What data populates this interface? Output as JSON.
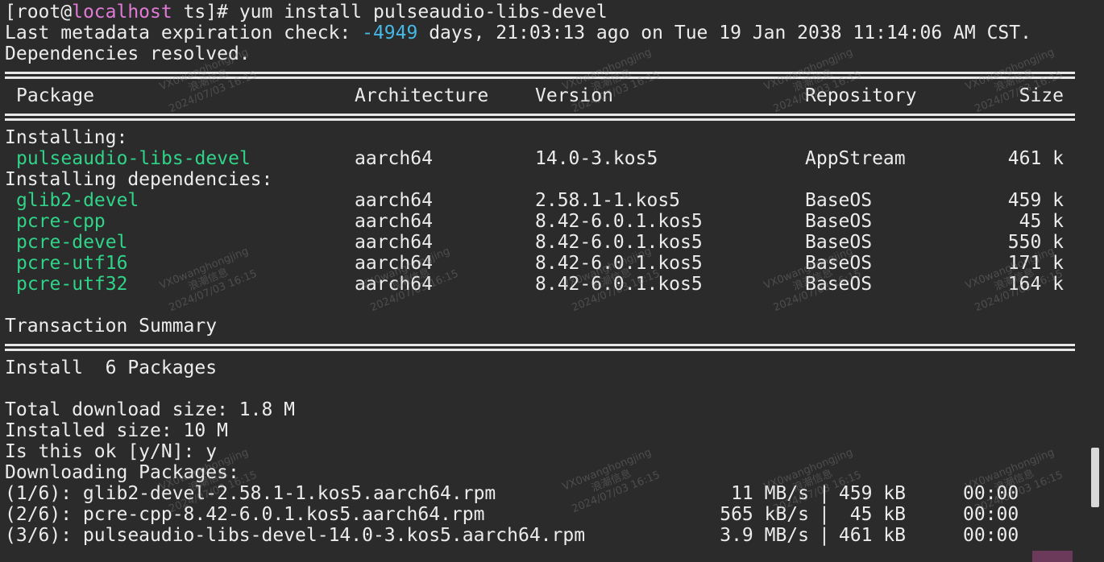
{
  "prompt": {
    "open": "[root@",
    "host": "localhost",
    "rest": " ts]# ",
    "command": "yum install pulseaudio-libs-devel"
  },
  "metadata": {
    "prefix": "Last metadata expiration check: ",
    "days": "-4949",
    "suffix": " days, 21:03:13 ago on Tue 19 Jan 2038 11:14:06 AM CST."
  },
  "deps_resolved": "Dependencies resolved.",
  "headers": {
    "package": "Package",
    "architecture": "Architecture",
    "version": "Version",
    "repository": "Repository",
    "size": "Size"
  },
  "installing_label": "Installing:",
  "installing": [
    {
      "name": "pulseaudio-libs-devel",
      "arch": "aarch64",
      "version": "14.0-3.kos5",
      "repo": "AppStream",
      "size": "461 k"
    }
  ],
  "deps_label": "Installing dependencies:",
  "dependencies": [
    {
      "name": "glib2-devel",
      "arch": "aarch64",
      "version": "2.58.1-1.kos5",
      "repo": "BaseOS",
      "size": "459 k"
    },
    {
      "name": "pcre-cpp",
      "arch": "aarch64",
      "version": "8.42-6.0.1.kos5",
      "repo": "BaseOS",
      "size": "45 k"
    },
    {
      "name": "pcre-devel",
      "arch": "aarch64",
      "version": "8.42-6.0.1.kos5",
      "repo": "BaseOS",
      "size": "550 k"
    },
    {
      "name": "pcre-utf16",
      "arch": "aarch64",
      "version": "8.42-6.0.1.kos5",
      "repo": "BaseOS",
      "size": "171 k"
    },
    {
      "name": "pcre-utf32",
      "arch": "aarch64",
      "version": "8.42-6.0.1.kos5",
      "repo": "BaseOS",
      "size": "164 k"
    }
  ],
  "summary": {
    "title": "Transaction Summary",
    "install": "Install  6 Packages",
    "download_size": "Total download size: 1.8 M",
    "installed_size": "Installed size: 10 M",
    "confirm": "Is this ok [y/N]: y",
    "downloading": "Downloading Packages:"
  },
  "downloads": [
    {
      "file": "(1/6): glib2-devel-2.58.1-1.kos5.aarch64.rpm",
      "speed": "11 MB/s",
      "sep": "|",
      "size": "459 kB",
      "time": "00:00"
    },
    {
      "file": "(2/6): pcre-cpp-8.42-6.0.1.kos5.aarch64.rpm",
      "speed": "565 kB/s",
      "sep": "|",
      "size": "45 kB",
      "time": "00:00"
    },
    {
      "file": "(3/6): pulseaudio-libs-devel-14.0-3.kos5.aarch64.rpm",
      "speed": "3.9 MB/s",
      "sep": "|",
      "size": "461 kB",
      "time": "00:00"
    }
  ],
  "watermark": {
    "line1": "VX0wanghongjing",
    "line2": "浪潮信息",
    "line3": "2024/07/03 16:15"
  },
  "colors": {
    "background": "#2b2b2b",
    "text": "#ececec",
    "package": "#2fd489",
    "host": "#e07ad6",
    "number": "#45b8e6"
  }
}
